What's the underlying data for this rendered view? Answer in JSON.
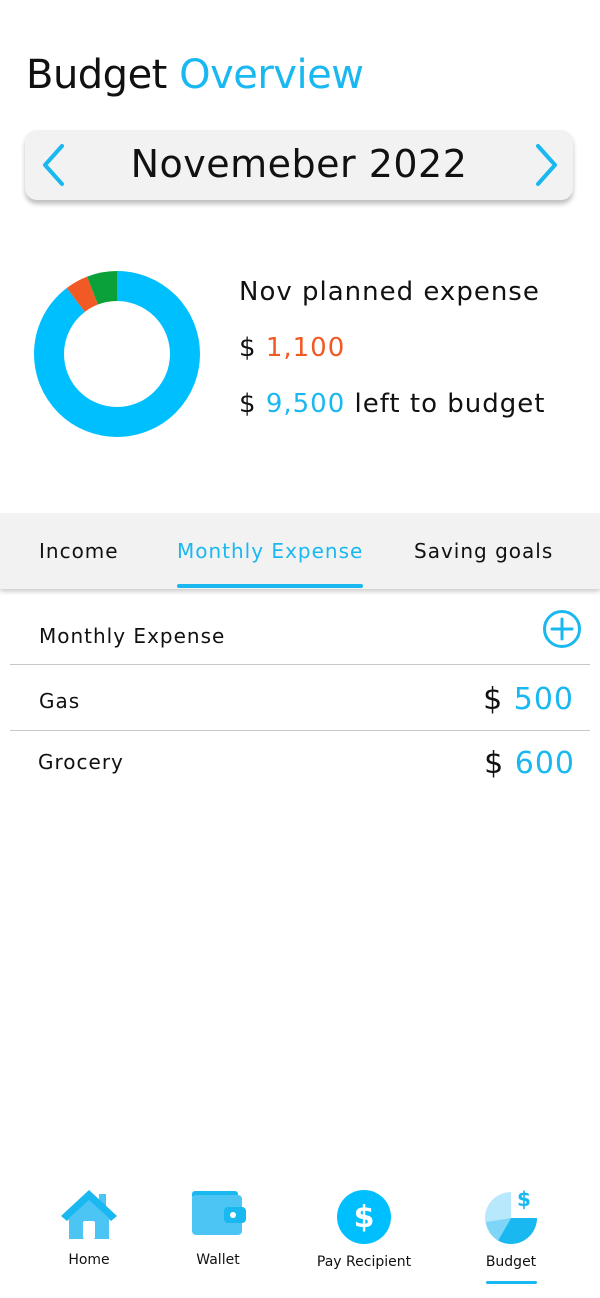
{
  "header": {
    "title_prefix": "Budget",
    "title_accent": "Overview"
  },
  "month_selector": {
    "label": "Novemeber 2022",
    "prev_icon": "chevron-left-icon",
    "next_icon": "chevron-right-icon"
  },
  "summary": {
    "planned_label": "Nov planned expense",
    "currency": "$",
    "planned_amount": "1,100",
    "left_amount": "9,500",
    "left_label": "left to budget"
  },
  "donut": {
    "segments": [
      {
        "name": "remaining",
        "color": "#00bfff",
        "fraction": 0.896
      },
      {
        "name": "gas",
        "color": "#f15a24",
        "fraction": 0.045
      },
      {
        "name": "grocery",
        "color": "#0aa13b",
        "fraction": 0.059
      }
    ]
  },
  "tabs": [
    {
      "label": "Income",
      "active": false
    },
    {
      "label": "Monthly Expense",
      "active": true
    },
    {
      "label": "Saving goals",
      "active": false
    }
  ],
  "expense_list": {
    "title": "Monthly Expense",
    "add_icon": "plus-circle-icon",
    "items": [
      {
        "label": "Gas",
        "currency": "$",
        "amount": "500"
      },
      {
        "label": "Grocery",
        "currency": "$",
        "amount": "600"
      }
    ]
  },
  "bottom_nav": {
    "items": [
      {
        "label": "Home",
        "icon": "home-icon"
      },
      {
        "label": "Wallet",
        "icon": "wallet-icon"
      },
      {
        "label": "Pay Recipient",
        "icon": "dollar-circle-icon"
      },
      {
        "label": "Budget",
        "icon": "budget-pie-icon",
        "active": true
      }
    ]
  },
  "colors": {
    "accent": "#1ab8f0",
    "expense": "#f15a24",
    "grocery_segment": "#0aa13b",
    "tab_bg": "#f2f2f2"
  }
}
